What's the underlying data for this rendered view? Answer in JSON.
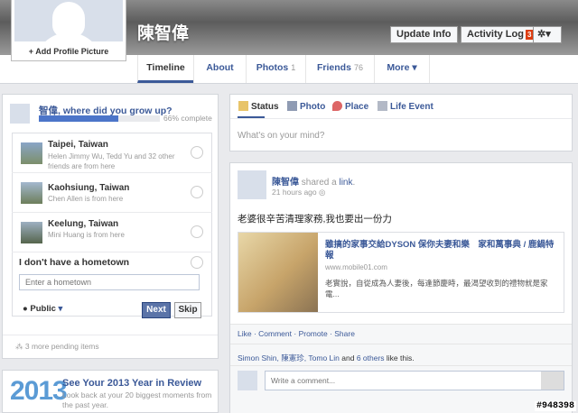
{
  "profile": {
    "name": "陳智偉",
    "add_picture": "+ Add Profile Picture"
  },
  "header": {
    "update_info": "Update Info",
    "activity_log": "Activity Log",
    "activity_count": "3",
    "settings_caret": "▾"
  },
  "tabs": [
    {
      "label": "Timeline"
    },
    {
      "label": "About"
    },
    {
      "label": "Photos",
      "count": "1"
    },
    {
      "label": "Friends",
      "count": "76"
    },
    {
      "label": "More ▾"
    }
  ],
  "hometown": {
    "question": "智偉, where did you grow up?",
    "progress_label": "66% complete",
    "progress": 0.66,
    "options": [
      {
        "place": "Taipei, Taiwan",
        "sub": "Helen Jimmy Wu, Tedd Yu and 32 other friends are from here"
      },
      {
        "place": "Kaohsiung, Taiwan",
        "sub": "Chen Allen is from here"
      },
      {
        "place": "Keelung, Taiwan",
        "sub": "Mini Huang is from here"
      }
    ],
    "none": "I don't have a hometown",
    "placeholder": "Enter a hometown",
    "privacy": "Public",
    "next": "Next",
    "skip": "Skip",
    "pending": "3 more pending items"
  },
  "review": {
    "year": "2013",
    "title": "See Your 2013 Year in Review",
    "sub": "Look back at your 20 biggest moments from the past year."
  },
  "composer": {
    "status": "Status",
    "photo": "Photo",
    "place": "Place",
    "life_event": "Life Event",
    "placeholder": "What's on your mind?"
  },
  "post": {
    "author": "陳智偉",
    "action_pre": "shared a ",
    "action_link": "link",
    "action_post": ".",
    "time": "21 hours ago",
    "text": "老婆很辛苦清理家務,我也要出一份力",
    "link_title": "雖搞的家事交給DYSON 保你夫妻和樂　家和萬事典 / 鹿鍋特報",
    "link_domain": "www.mobile01.com",
    "link_desc": "老實說，自從成為人妻後，每逢節慶時，最渴望收到的禮物就是家電...",
    "actions": {
      "like": "Like",
      "comment": "Comment",
      "promote": "Promote",
      "share": "Share"
    },
    "likes_names": "Simon Shin, 陳憲珍, Tomo Lin",
    "likes_mid": " and ",
    "likes_others": "6 others",
    "likes_end": " like this.",
    "comment_placeholder": "Write a comment..."
  },
  "watermark": "#948398"
}
